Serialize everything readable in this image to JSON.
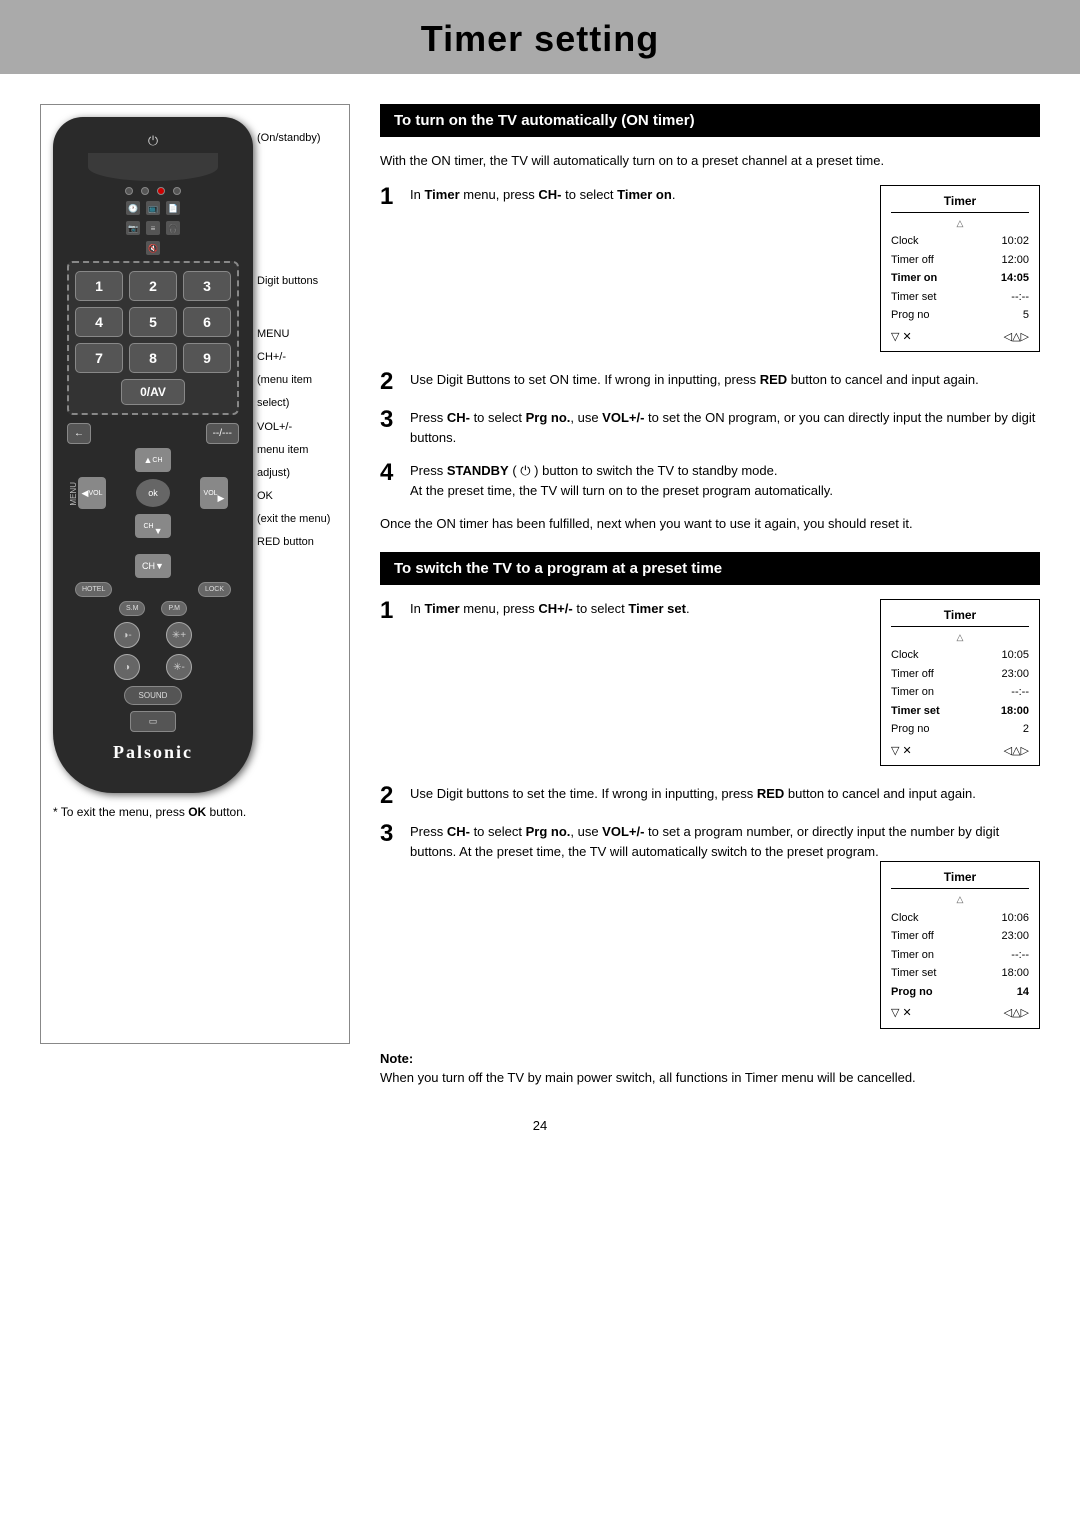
{
  "page": {
    "title": "Timer setting",
    "page_number": "24"
  },
  "header": {
    "title": "Timer setting"
  },
  "remote": {
    "brand": "Palsonic",
    "buttons": {
      "standby": "⏻",
      "numbers": [
        "1",
        "2",
        "3",
        "4",
        "5",
        "6",
        "7",
        "8",
        "9"
      ],
      "zero_av": "0/AV",
      "return": "←",
      "dash": "--/---",
      "ok": "ok",
      "menu": "MENU",
      "ch_plus": "CH+",
      "vol_up": "VOL▶",
      "vol_down": "◀VOL",
      "ch_down": "CH▼",
      "hotel": "HOTEL",
      "lock": "LOCK",
      "sm": "S.M",
      "pm": "P.M",
      "sound": "SOUND"
    },
    "annotations": [
      "(On/standby)",
      "Digit buttons",
      "MENU",
      "CH+/-",
      "(menu item",
      "select)",
      "VOL+/-",
      "menu item",
      "adjust)",
      "OK",
      "(exit the menu)",
      "RED button"
    ],
    "footnote": "* To exit the menu, press OK button."
  },
  "section1": {
    "header": "To turn on the TV automatically (ON timer)",
    "intro": "With the ON timer, the TV will automatically turn on to a preset channel at a preset time.",
    "steps": [
      {
        "num": "1",
        "text": "In Timer menu, press CH- to select Timer on."
      },
      {
        "num": "2",
        "text": "Use Digit Buttons to set ON time. If wrong in inputting, press RED button to cancel and input again."
      },
      {
        "num": "3",
        "text": "Press CH- to select Prg no., use VOL+/- to set the ON program, or you can directly input the number by digit buttons."
      },
      {
        "num": "4",
        "text": "Press STANDBY ( ⏻ ) button to switch the TV to standby mode.\nAt the preset time, the TV will turn on to the preset program automatically."
      }
    ],
    "timer_box_1": {
      "title": "Timer",
      "rows": [
        {
          "label": "Clock",
          "value": "10:02",
          "bold": false
        },
        {
          "label": "Timer off",
          "value": "12:00",
          "bold": false
        },
        {
          "label": "Timer on",
          "value": "14:05",
          "bold": true
        },
        {
          "label": "Timer set",
          "value": "--:--",
          "bold": false
        },
        {
          "label": "Prog no",
          "value": "5",
          "bold": false
        }
      ],
      "nav": "▽  ✕     ◁△▷"
    },
    "followup_text": "Once the ON timer has been fulfilled, next when you want to use it again, you should reset it."
  },
  "section2": {
    "header": "To switch the TV to a program at a preset time",
    "steps": [
      {
        "num": "1",
        "text": "In Timer menu, press CH+/- to select Timer set."
      },
      {
        "num": "2",
        "text": "Use Digit buttons to set the time. If wrong in inputting, press RED button to cancel and input again."
      },
      {
        "num": "3",
        "text": "Press CH- to select Prg no., use VOL+/- to set a program number, or directly input the number by digit buttons. At the preset time, the TV will automatically switch to the preset program."
      }
    ],
    "timer_box_2": {
      "title": "Timer",
      "rows": [
        {
          "label": "Clock",
          "value": "10:05",
          "bold": false
        },
        {
          "label": "Timer off",
          "value": "23:00",
          "bold": false
        },
        {
          "label": "Timer on",
          "value": "--:--",
          "bold": false
        },
        {
          "label": "Timer set",
          "value": "18:00",
          "bold": true
        },
        {
          "label": "Prog no",
          "value": "2",
          "bold": false
        }
      ],
      "nav": "▽  ✕     ◁△▷"
    },
    "timer_box_3": {
      "title": "Timer",
      "rows": [
        {
          "label": "Clock",
          "value": "10:06",
          "bold": false
        },
        {
          "label": "Timer off",
          "value": "23:00",
          "bold": false
        },
        {
          "label": "Timer on",
          "value": "--:--",
          "bold": false
        },
        {
          "label": "Timer set",
          "value": "18:00",
          "bold": false
        },
        {
          "label": "Prog no",
          "value": "14",
          "bold": true
        }
      ],
      "nav": "▽  ✕     ◁△▷"
    }
  },
  "note": {
    "label": "Note:",
    "text": "When you turn off the TV by main power switch, all functions in Timer menu will be cancelled."
  }
}
